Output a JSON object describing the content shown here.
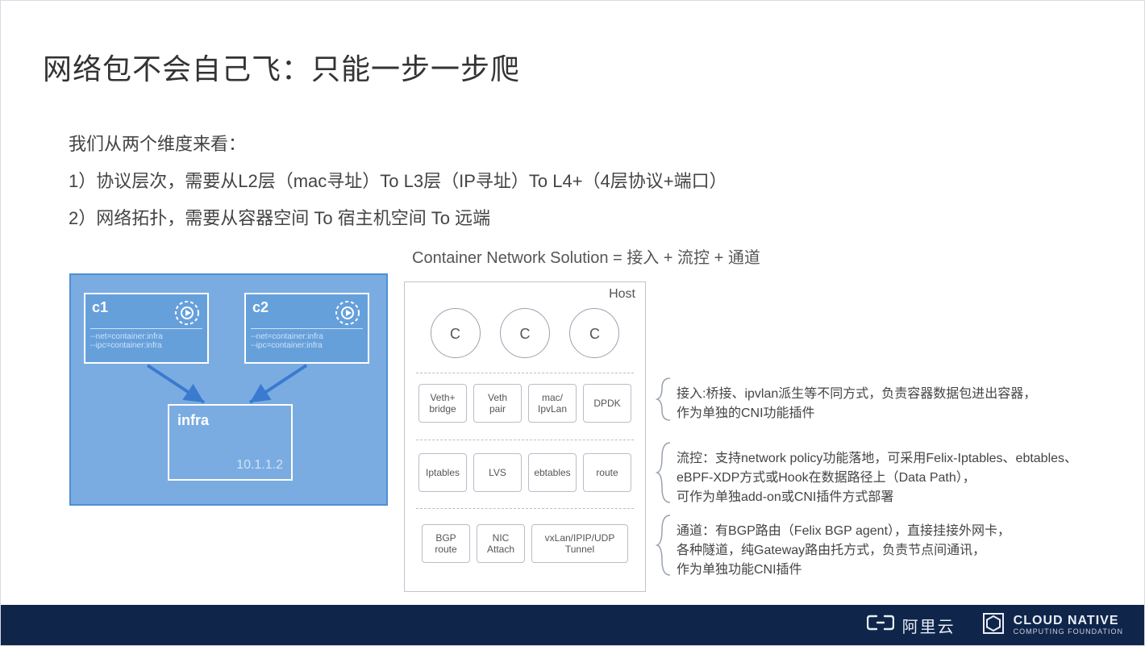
{
  "title": "网络包不会自己飞：只能一步一步爬",
  "intro": {
    "line0": "我们从两个维度来看：",
    "line1": "1）协议层次，需要从L2层（mac寻址）To  L3层（IP寻址）To L4+（4层协议+端口）",
    "line2": "2）网络拓扑，需要从容器空间 To 宿主机空间 To 远端"
  },
  "equation": "Container Network Solution = 接入 + 流控 + 通道",
  "left_diagram": {
    "c1": {
      "label": "c1",
      "config": "--net=container:infra\n--ipc=container:infra"
    },
    "c2": {
      "label": "c2",
      "config": "--net=container:infra\n--ipc=container:infra"
    },
    "infra": {
      "label": "infra",
      "ip": "10.1.1.2"
    }
  },
  "host_diagram": {
    "title": "Host",
    "circles": [
      "C",
      "C",
      "C"
    ],
    "row1": [
      "Veth+\nbridge",
      "Veth\npair",
      "mac/\nIpvLan",
      "DPDK"
    ],
    "row2": [
      "Iptables",
      "LVS",
      "ebtables",
      "route"
    ],
    "row3": [
      "BGP\nroute",
      "NIC\nAttach",
      "vxLan/IPIP/UDP\nTunnel"
    ]
  },
  "annotations": {
    "a1": {
      "label": "接入:",
      "body": "桥接、ipvlan派生等不同方式，负责容器数据包进出容器，\n作为单独的CNI功能插件"
    },
    "a2": {
      "label": "流控：",
      "body": "支持network policy功能落地，可采用Felix-Iptables、ebtables、\neBPF-XDP方式或Hook在数据路径上（Data Path），\n可作为单独add-on或CNI插件方式部署"
    },
    "a3": {
      "label": "通道：",
      "body": "有BGP路由（Felix BGP agent），直接挂接外网卡，\n各种隧道，纯Gateway路由托方式，负责节点间通讯，\n作为单独功能CNI插件"
    }
  },
  "footer": {
    "aliyun": "阿里云",
    "cncf_big": "CLOUD NATIVE",
    "cncf_small": "COMPUTING FOUNDATION"
  }
}
